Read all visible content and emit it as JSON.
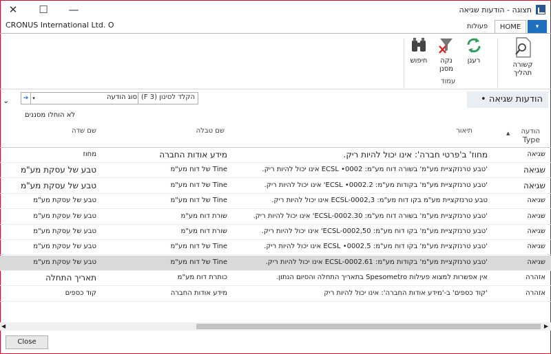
{
  "window": {
    "title": "תצוגה - הודעות שגיאה",
    "minimize": "—",
    "maximize": "☐",
    "close": "✕",
    "company": "CRONUS International Ltd. O"
  },
  "ribbon": {
    "tabs": {
      "file": "▾",
      "home": "HOME",
      "actions": "פעולות"
    },
    "buttons": {
      "show_link": [
        "קשורה",
        "תהליך"
      ],
      "refresh": "רענן",
      "clear_filter": [
        "נקה",
        "מסנן"
      ],
      "find": "חיפוש"
    },
    "groups": {
      "show": "",
      "page": "עמוד"
    }
  },
  "page": {
    "title": "הודעות שגיאה •",
    "filter_hint": "הקלד לסינון (F 3)",
    "filter_field": "סוג הודעה",
    "no_filters": "לא הוחלו מסננים"
  },
  "table": {
    "headers": {
      "type_line1": "הודעה",
      "type_line2": "Type",
      "description": "תיאור",
      "table_name": "שם טבלה",
      "field_name": "שם שדה"
    },
    "rows": [
      {
        "type": "שגיאה",
        "description": "מחוז' ב'פרטי חברה': אינו יכול להיות ריק.",
        "table": "מידע אודות החברה",
        "field": "מחוז",
        "big_desc": true,
        "big_table": true,
        "big_field": false
      },
      {
        "type": "שגיאה",
        "description": "'טבע טרנזקציית מע\"מ' בשורה דוח מע\"מ: ECSL •0002 אינו יכול להיות ריק.",
        "table": "Tine של דוח מע\"מ",
        "field": "טבע של עסקת מע\"מ",
        "big_type": true,
        "big_field": true
      },
      {
        "type": "שגיאה",
        "description": "'טבע טרנזקציית מע\"מ' בקודות מע\"מ: ECSL •0002.2' אינו יכול להיות ריק.",
        "table": "Tine של דוח מע\"מ",
        "field": "טבע של עסקת מע\"מ",
        "big_type": true,
        "big_field": true
      },
      {
        "type": "שגיאה",
        "description": "טבע טרנזקציית מע\"מ בקו דוח מע\"מ: ECSL-0002,3 אינו יכול להיות ריק.",
        "table": "Tine של דוח מע\"מ",
        "field": "טבע של עסקת מע\"מ"
      },
      {
        "type": "שגיאה",
        "description": "'טבע טרנזקציית מע\"מ' בשורה דוח מע\"מ: ECSL-0002.30' אינו יכול להיות ריק.",
        "table": "שורת דוח מע\"מ",
        "field": "טבע של עסקת מע\"מ"
      },
      {
        "type": "שגיאה",
        "description": "'טבע טרנזקציית מע\"מ' בקו דוח מע\"מ: ECSL-0002,50' אינו יכול להיות ריק.",
        "table": "שורת דוח מע\"מ",
        "field": "טבע של עסקת מע\"מ"
      },
      {
        "type": "שגיאה",
        "description": "'טבע טרנזקציית מע\"מ' בקו דוח מע\"מ: ECSL •0002.5 אינו יכול להיות ריק.",
        "table": "Tine של דוח מע\"מ",
        "field": "טבע של עסקת מע\"מ"
      },
      {
        "type": "שגיאה",
        "description": "'טבע טרנזקציית מע\"מ' בקודות מע\"מ: ECSL-0002.61 אינו יכול להיות ריק.",
        "table": "Tine של דוח מע\"מ",
        "field": "טבע של עסקת מע\"מ",
        "selected": true
      },
      {
        "type": "אזהרה",
        "description": "אין אפשרות למצוא פעילות Spesometro בתאריך התחלה והסיום הנתון.",
        "table": "כותרת דוח מע\"מ",
        "field": "תאריך התחלה",
        "big_field": true
      },
      {
        "type": "אזהרה",
        "description": "'קוד כספים' ב-'מידע אודות החברה': אינו יכול להיות ריק",
        "table": "מידע אודות החברה",
        "field": "קוד כספים"
      }
    ]
  },
  "footer": {
    "close": "Close"
  }
}
